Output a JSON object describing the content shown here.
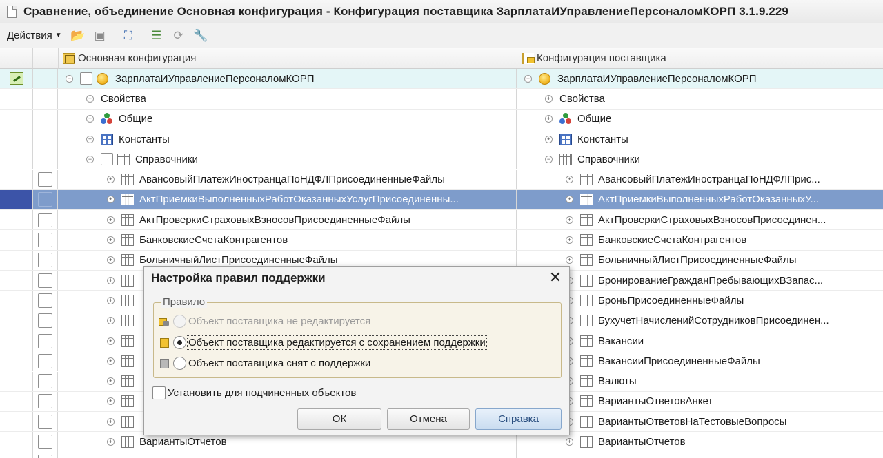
{
  "window": {
    "title": "Сравнение, объединение Основная конфигурация - Конфигурация поставщика ЗарплатаИУправлениеПерсоналомКОРП 3.1.9.229"
  },
  "toolbar": {
    "actions_label": "Действия",
    "buttons": [
      "open-folder-icon",
      "save-icon",
      "filter-icon",
      "list-icon",
      "refresh-icon",
      "wrench-icon"
    ]
  },
  "grid": {
    "left_header": "Основная конфигурация",
    "right_header": "Конфигурация поставщика",
    "root_name": "ЗарплатаИУправлениеПерсоналомКОРП",
    "groups": {
      "props": "Свойства",
      "common": "Общие",
      "constants": "Константы",
      "catalogs": "Справочники"
    },
    "left_items": [
      "АвансовыйПлатежИностранцаПоНДФЛПрисоединенныеФайлы",
      "АктПриемкиВыполненныхРаботОказанныхУслугПрисоединенны...",
      "АктПроверкиСтраховыхВзносовПрисоединенныеФайлы",
      "БанковскиеСчетаКонтрагентов",
      "БольничныйЛистПрисоединенныеФайлы",
      "",
      "",
      "",
      "",
      "",
      "",
      "",
      "",
      "ВариантыОтчетов"
    ],
    "right_items": [
      "АвансовыйПлатежИностранцаПоНДФЛПрис...",
      "АктПриемкиВыполненныхРаботОказанныхУ...",
      "АктПроверкиСтраховыхВзносовПрисоединен...",
      "БанковскиеСчетаКонтрагентов",
      "БольничныйЛистПрисоединенныеФайлы",
      "БронированиеГражданПребывающихВЗапас...",
      "БроньПрисоединенныеФайлы",
      "БухучетНачисленийСотрудниковПрисоединен...",
      "Вакансии",
      "ВакансииПрисоединенныеФайлы",
      "Валюты",
      "ВариантыОтветовАнкет",
      "ВариантыОтветовНаТестовыеВопросы",
      "ВариантыОтчетов"
    ]
  },
  "dialog": {
    "title": "Настройка правил поддержки",
    "group_label": "Правило",
    "options": [
      "Объект поставщика не редактируется",
      "Объект поставщика редактируется с сохранением поддержки",
      "Объект поставщика снят с поддержки"
    ],
    "selected_option": 1,
    "subordinate_label": "Установить для подчиненных объектов",
    "ok_label": "ОК",
    "cancel_label": "Отмена",
    "help_label": "Справка"
  },
  "colors": {
    "selection": "#7e9ccb",
    "root_row": "#e4f6f7",
    "help_button": "#c9dcf0"
  }
}
